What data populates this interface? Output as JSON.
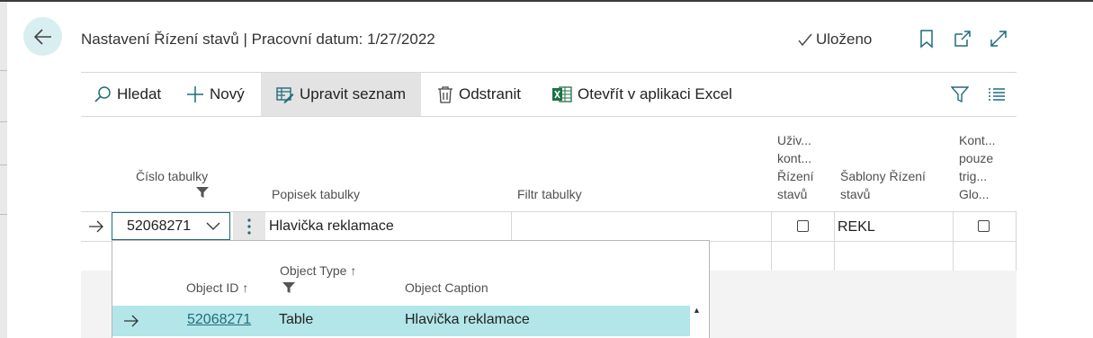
{
  "header": {
    "title": "Nastavení Řízení stavů | Pracovní datum: 1/27/2022",
    "saved_status": "Uloženo"
  },
  "actions": {
    "search": "Hledat",
    "new": "Nový",
    "edit_list": "Upravit seznam",
    "delete": "Odstranit",
    "open_excel": "Otevřít v aplikaci Excel"
  },
  "columns": {
    "table_no": "Číslo tabulky",
    "table_caption": "Popisek tabulky",
    "table_filter": "Filtr tabulky",
    "user_control": [
      "Uživ...",
      "kont...",
      "Řízení",
      "stavů"
    ],
    "templates": [
      "Šablony Řízení",
      "stavů"
    ],
    "control_trigger": [
      "Kont...",
      "pouze",
      "trig...",
      "Glo..."
    ]
  },
  "row": {
    "table_no": "52068271",
    "table_caption": "Hlavička reklamace",
    "table_filter": "",
    "user_control_checked": false,
    "template": "REKL",
    "control_trigger_checked": false
  },
  "lookup": {
    "columns": {
      "object_id": "Object ID",
      "object_type": "Object Type",
      "object_caption": "Object Caption"
    },
    "rows": [
      {
        "object_id": "52068271",
        "object_type": "Table",
        "object_caption": "Hlavička reklamace"
      }
    ]
  },
  "colors": {
    "accent": "#1f6c7a",
    "selected_row": "#b3e6e9",
    "back_button_bg": "#d9eef1",
    "excel_green": "#1e7145"
  }
}
